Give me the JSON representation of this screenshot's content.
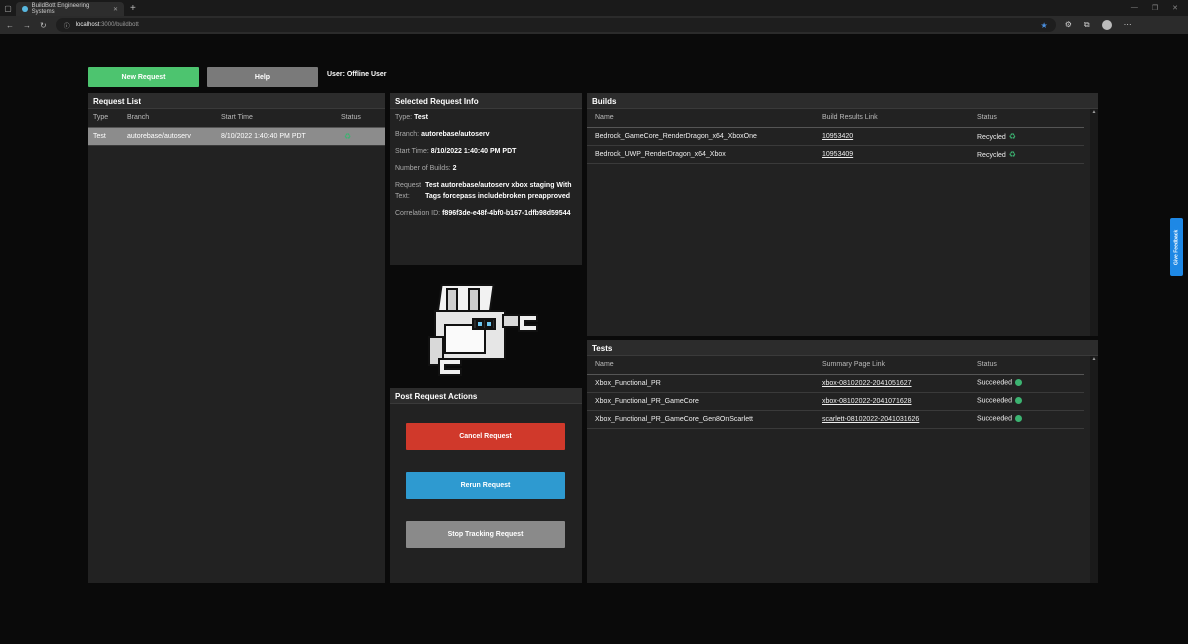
{
  "browser": {
    "tab_title": "BuildBott Engineering Systems",
    "url_host": "localhost",
    "url_path": ":3000/buildbott"
  },
  "toolbar": {
    "new_request": "New Request",
    "help": "Help",
    "user": "User: Offline User"
  },
  "request_list": {
    "title": "Request List",
    "headers": [
      "Type",
      "Branch",
      "Start Time",
      "Status"
    ],
    "rows": [
      {
        "type": "Test",
        "branch": "autorebase/autoserv",
        "start": "8/10/2022 1:40:40 PM PDT"
      }
    ]
  },
  "selected": {
    "title": "Selected Request Info",
    "type_label": "Type:",
    "type_value": "Test",
    "branch_label": "Branch:",
    "branch_value": "autorebase/autoserv",
    "start_label": "Start Time:",
    "start_value": "8/10/2022 1:40:40 PM PDT",
    "builds_label": "Number of Builds:",
    "builds_value": "2",
    "request_label1": "Request",
    "request_label2": "Text:",
    "request_value1": "Test autorebase/autoserv xbox staging With",
    "request_value2": "Tags forcepass includebroken preapproved",
    "corr_label": "Correlation ID:",
    "corr_value": "f896f3de-e48f-4bf0-b167-1dfb98d59544"
  },
  "actions": {
    "title": "Post Request Actions",
    "cancel": "Cancel Request",
    "rerun": "Rerun Request",
    "stop": "Stop Tracking Request"
  },
  "builds": {
    "title": "Builds",
    "headers": [
      "Name",
      "Build Results Link",
      "Status"
    ],
    "rows": [
      {
        "name": "Bedrock_GameCore_RenderDragon_x64_XboxOne",
        "link": "10953420",
        "status": "Recycled"
      },
      {
        "name": "Bedrock_UWP_RenderDragon_x64_Xbox",
        "link": "10953409",
        "status": "Recycled"
      }
    ]
  },
  "tests": {
    "title": "Tests",
    "headers": [
      "Name",
      "Summary Page Link",
      "Status"
    ],
    "rows": [
      {
        "name": "Xbox_Functional_PR",
        "link": "xbox-08102022-2041051627",
        "status": "Succeeded"
      },
      {
        "name": "Xbox_Functional_PR_GameCore",
        "link": "xbox-08102022-2041071628",
        "status": "Succeeded"
      },
      {
        "name": "Xbox_Functional_PR_GameCore_Gen8OnScarlett",
        "link": "scarlett-08102022-2041031626",
        "status": "Succeeded"
      }
    ]
  },
  "feedback": "Give Feedback",
  "colors": {
    "green": "#4dc46f",
    "gray": "#7a7a7a",
    "red": "#d0392b",
    "blue": "#2e9ad0",
    "stop": "#8a8a8a"
  }
}
